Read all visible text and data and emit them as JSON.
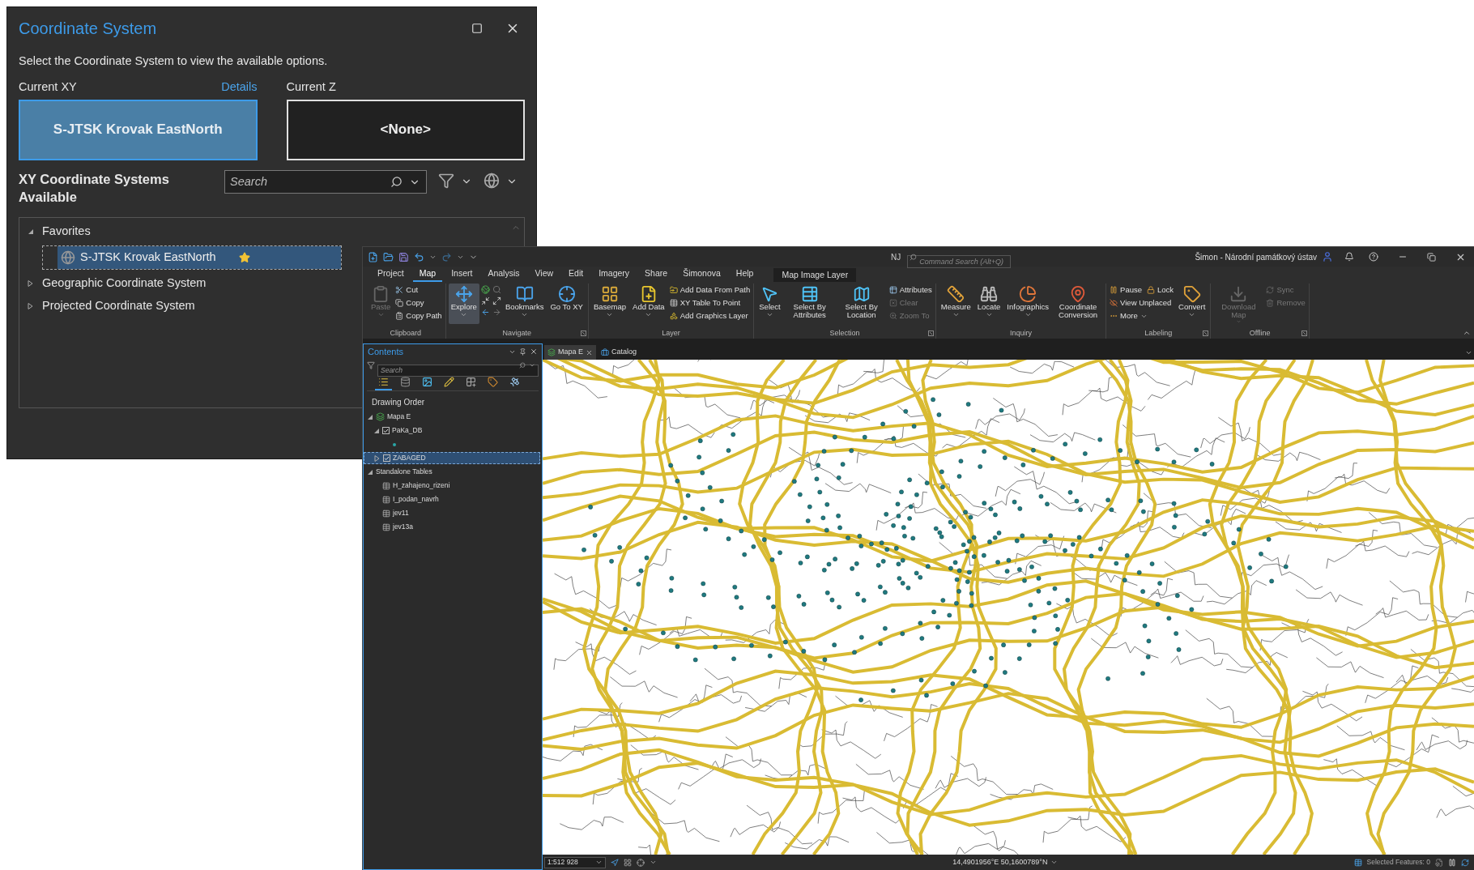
{
  "coordinate_dialog": {
    "title": "Coordinate System",
    "description": "Select the Coordinate System to view the available options.",
    "current_xy": {
      "label": "Current XY",
      "link": "Details",
      "value": "S-JTSK Krovak EastNorth"
    },
    "current_z": {
      "label": "Current Z",
      "value": "<None>"
    },
    "available_label": "XY Coordinate Systems Available",
    "search": {
      "placeholder": "Search"
    },
    "tree": [
      {
        "label": "Favorites",
        "expanded": true,
        "children": [
          {
            "label": "S-JTSK Krovak EastNorth",
            "selected": true,
            "favorite": true
          }
        ]
      },
      {
        "label": "Geographic Coordinate System",
        "expanded": false
      },
      {
        "label": "Projected Coordinate System",
        "expanded": false
      }
    ]
  },
  "app": {
    "user_initials": "NJ",
    "command_search": {
      "placeholder": "Command Search (Alt+Q)"
    },
    "account": "Šimon - Národní památkový ústav",
    "tabs": [
      {
        "label": "Project",
        "selected": false
      },
      {
        "label": "Map",
        "selected": true
      },
      {
        "label": "Insert",
        "selected": false
      },
      {
        "label": "Analysis",
        "selected": false
      },
      {
        "label": "View",
        "selected": false
      },
      {
        "label": "Edit",
        "selected": false
      },
      {
        "label": "Imagery",
        "selected": false
      },
      {
        "label": "Share",
        "selected": false
      },
      {
        "label": "Šimonova",
        "selected": false
      },
      {
        "label": "Help",
        "selected": false
      }
    ],
    "contextual_tab": "Map Image Layer",
    "ribbon_groups": [
      {
        "label": "Clipboard",
        "launcher": false,
        "items": [
          {
            "kind": "large",
            "label": "Paste",
            "disabled": true,
            "dropdown": true
          },
          {
            "kind": "stack",
            "rows": [
              [
                {
                  "label": "Cut",
                  "disabled": false
                }
              ],
              [
                {
                  "label": "Copy",
                  "disabled": false
                }
              ],
              [
                {
                  "label": "Copy Path",
                  "disabled": false
                }
              ]
            ]
          }
        ]
      },
      {
        "label": "Navigate",
        "launcher": true,
        "items": [
          {
            "kind": "large",
            "label": "Explore",
            "disabled": false,
            "dropdown": true,
            "selected": true
          },
          {
            "kind": "nav-grid"
          },
          {
            "kind": "large",
            "label": "Bookmarks",
            "disabled": false,
            "dropdown": true
          },
          {
            "kind": "large",
            "label": "Go To XY",
            "disabled": false,
            "dropdown": false
          }
        ]
      },
      {
        "label": "Layer",
        "launcher": false,
        "items": [
          {
            "kind": "large",
            "label": "Basemap",
            "disabled": false,
            "dropdown": true
          },
          {
            "kind": "large",
            "label": "Add Data",
            "disabled": false,
            "dropdown": true
          },
          {
            "kind": "stack",
            "rows": [
              [
                {
                  "label": "Add Data From Path",
                  "disabled": false
                }
              ],
              [
                {
                  "label": "XY Table To Point",
                  "disabled": false
                }
              ],
              [
                {
                  "label": "Add Graphics Layer",
                  "disabled": false
                }
              ]
            ]
          }
        ]
      },
      {
        "label": "Selection",
        "launcher": true,
        "items": [
          {
            "kind": "large",
            "label": "Select",
            "disabled": false,
            "dropdown": true
          },
          {
            "kind": "large",
            "label": "Select By Attributes",
            "disabled": false,
            "dropdown": false
          },
          {
            "kind": "large",
            "label": "Select By Location",
            "disabled": false,
            "dropdown": false
          },
          {
            "kind": "stack",
            "rows": [
              [
                {
                  "label": "Attributes",
                  "disabled": false
                }
              ],
              [
                {
                  "label": "Clear",
                  "disabled": true
                }
              ],
              [
                {
                  "label": "Zoom To",
                  "disabled": true
                }
              ]
            ]
          }
        ]
      },
      {
        "label": "Inquiry",
        "launcher": false,
        "items": [
          {
            "kind": "large",
            "label": "Measure",
            "disabled": false,
            "dropdown": true
          },
          {
            "kind": "large",
            "label": "Locate",
            "disabled": false,
            "dropdown": true
          },
          {
            "kind": "large",
            "label": "Infographics",
            "disabled": false,
            "dropdown": true
          },
          {
            "kind": "large",
            "label": "Coordinate Conversion",
            "disabled": false,
            "dropdown": false
          }
        ]
      },
      {
        "label": "Labeling",
        "launcher": true,
        "items": [
          {
            "kind": "stack",
            "rows": [
              [
                {
                  "label": "Pause",
                  "disabled": false
                },
                {
                  "label": "Lock",
                  "disabled": false
                }
              ],
              [
                {
                  "label": "View Unplaced",
                  "disabled": false
                }
              ],
              [
                {
                  "label": "More",
                  "disabled": false,
                  "dropdown": true
                }
              ]
            ]
          },
          {
            "kind": "large",
            "label": "Convert",
            "disabled": false,
            "dropdown": true
          }
        ]
      },
      {
        "label": "Offline",
        "launcher": true,
        "items": [
          {
            "kind": "large",
            "label": "Download Map",
            "disabled": true,
            "dropdown": true
          },
          {
            "kind": "stack",
            "rows": [
              [
                {
                  "label": "Sync",
                  "disabled": true
                }
              ],
              [
                {
                  "label": "Remove",
                  "disabled": true
                }
              ]
            ]
          }
        ]
      }
    ],
    "contents": {
      "title": "Contents",
      "search": {
        "placeholder": "Search"
      },
      "views": [
        {
          "selected": true
        },
        {
          "selected": false
        },
        {
          "selected": false
        },
        {
          "selected": false
        },
        {
          "selected": false
        },
        {
          "selected": false
        },
        {
          "selected": false
        }
      ],
      "section": "Drawing Order",
      "tree": [
        {
          "kind": "map",
          "label": "Mapa E",
          "expanded": true,
          "children": [
            {
              "kind": "layer",
              "label": "PaKa_DB",
              "checked": true,
              "expanded": true,
              "selected": false,
              "children": [
                {
                  "kind": "symbol"
                }
              ]
            },
            {
              "kind": "layer",
              "label": "ZABAGED",
              "checked": true,
              "expanded": false,
              "selected": true
            }
          ]
        },
        {
          "kind": "folder",
          "label": "Standalone Tables",
          "expanded": true,
          "children": [
            {
              "kind": "table",
              "label": "H_zahajeno_rizeni"
            },
            {
              "kind": "table",
              "label": "I_podan_navrh"
            },
            {
              "kind": "table",
              "label": "jev11"
            },
            {
              "kind": "table",
              "label": "jev13a"
            }
          ]
        }
      ]
    },
    "map_tabs": [
      {
        "label": "Mapa E",
        "selected": true,
        "kind": "map"
      },
      {
        "label": "Catalog",
        "selected": false,
        "kind": "catalog"
      }
    ],
    "status_bar": {
      "scale": "1:512 928",
      "coordinates": "14,4901956°E 50,1600789°N",
      "selected_features": "Selected Features: 0"
    }
  }
}
